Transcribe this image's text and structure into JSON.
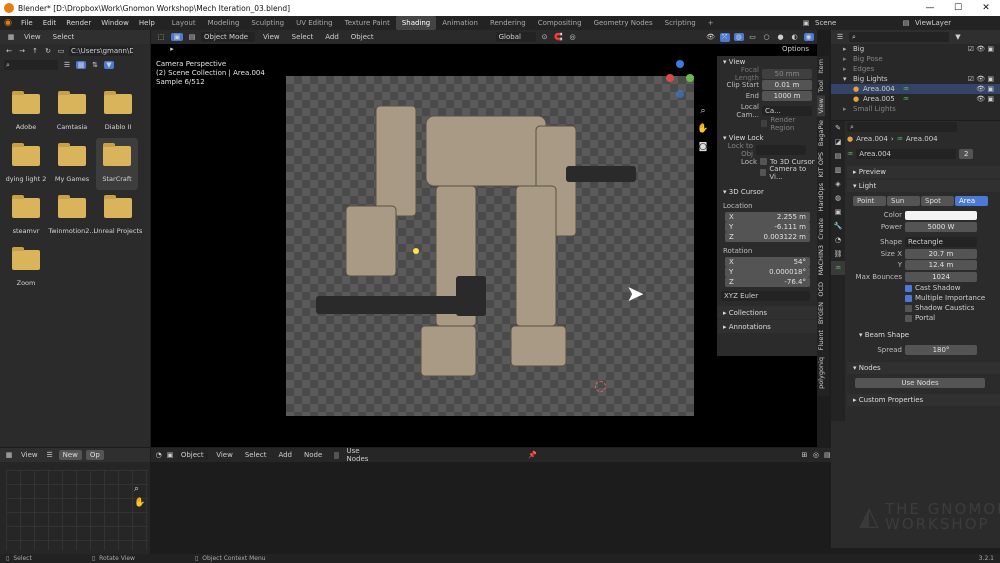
{
  "title_bar": {
    "text": "Blender* [D:\\Dropbox\\Work\\Gnomon Workshop\\Mech Iteration_03.blend]"
  },
  "menu": {
    "items": [
      "File",
      "Edit",
      "Render",
      "Window",
      "Help"
    ],
    "workspaces": [
      "Layout",
      "Modeling",
      "Sculpting",
      "UV Editing",
      "Texture Paint",
      "Shading",
      "Animation",
      "Rendering",
      "Compositing",
      "Geometry Nodes",
      "Scripting"
    ],
    "active_workspace": "Shading",
    "add_label": "+",
    "scene_label": "Scene",
    "viewlayer_label": "ViewLayer"
  },
  "file_browser": {
    "header": {
      "view": "View",
      "select": "Select"
    },
    "path": "C:\\Users\\gmann\\Docu...",
    "folders": [
      "Adobe",
      "Camtasia",
      "Diablo II",
      "dying light 2",
      "My Games",
      "StarCraft",
      "steamvr",
      "Twinmotion2...",
      "Unreal Projects",
      "Zoom"
    ]
  },
  "viewport": {
    "mode": "Object Mode",
    "menus": [
      "View",
      "Select",
      "Add",
      "Object"
    ],
    "transform": "Global",
    "options": "Options",
    "overlay": {
      "line1": "Camera Perspective",
      "line2": "(2) Scene Collection | Area.004",
      "line3": "Sample 6/512"
    }
  },
  "n_panel": {
    "view_title": "View",
    "focal_length": {
      "label": "Focal Length",
      "value": "50 mm"
    },
    "clip_start": {
      "label": "Clip Start",
      "value": "0.01 m"
    },
    "clip_end": {
      "label": "End",
      "value": "1000 m"
    },
    "local_camera": {
      "label": "Local Cam...",
      "value": "Ca..."
    },
    "render_region": "Render Region",
    "view_lock_title": "View Lock",
    "lock_to_object": "Lock to Obj",
    "lock_label": "Lock",
    "to_3d_cursor": "To 3D Cursor",
    "camera_to_view": "Camera to Vi...",
    "cursor_title": "3D Cursor",
    "location_label": "Location",
    "loc": [
      {
        "axis": "X",
        "value": "2.255 m"
      },
      {
        "axis": "Y",
        "value": "-6.111 m"
      },
      {
        "axis": "Z",
        "value": "0.003122 m"
      }
    ],
    "rotation_label": "Rotation",
    "rot": [
      {
        "axis": "X",
        "value": "54°"
      },
      {
        "axis": "Y",
        "value": "0.000018°"
      },
      {
        "axis": "Z",
        "value": "-76.4°"
      }
    ],
    "rotation_mode": "XYZ Euler",
    "collections": "Collections",
    "annotations": "Annotations",
    "tabs": [
      "Item",
      "Tool",
      "View",
      "BagaPie",
      "KIT OPS",
      "HardOps",
      "Create",
      "MACHIN3",
      "OCD",
      "BYGEN",
      "Fluent",
      "polygoniq"
    ]
  },
  "outliner": {
    "items": [
      {
        "name": "Big",
        "indent": 0
      },
      {
        "name": "Big Pose",
        "indent": 0
      },
      {
        "name": "Edges",
        "indent": 0
      },
      {
        "name": "Big Lights",
        "indent": 0
      },
      {
        "name": "Area.004",
        "indent": 1
      },
      {
        "name": "Area.005",
        "indent": 1
      },
      {
        "name": "Small Lights",
        "indent": 0
      }
    ]
  },
  "properties": {
    "breadcrumb": [
      "Area.004",
      "Area.004"
    ],
    "datablock": "Area.004",
    "users": "2",
    "preview": "Preview",
    "light": "Light",
    "light_types": [
      "Point",
      "Sun",
      "Spot",
      "Area"
    ],
    "active_light_type": "Area",
    "color_label": "Color",
    "power": {
      "label": "Power",
      "value": "5000 W"
    },
    "shape": {
      "label": "Shape",
      "value": "Rectangle"
    },
    "size_x": {
      "label": "Size X",
      "value": "20.7 m"
    },
    "size_y": {
      "label": "Y",
      "value": "12.4 m"
    },
    "max_bounces": {
      "label": "Max Bounces",
      "value": "1024"
    },
    "cast_shadow": "Cast Shadow",
    "multiple_importance": "Multiple Importance",
    "shadow_caustics": "Shadow Caustics",
    "portal": "Portal",
    "beam_shape": "Beam Shape",
    "spread": {
      "label": "Spread",
      "value": "180°"
    },
    "nodes": "Nodes",
    "use_nodes": "Use Nodes",
    "custom_properties": "Custom Properties"
  },
  "bottom_left": {
    "view": "View",
    "new": "New",
    "open": "Op"
  },
  "node_editor": {
    "mode": "Object",
    "menus": [
      "View",
      "Select",
      "Add",
      "Node"
    ],
    "use_nodes": "Use Nodes"
  },
  "status_bar": {
    "select": "Select",
    "rotate": "Rotate View",
    "context": "Object Context Menu",
    "version": "3.2.1"
  },
  "watermark": {
    "line1": "THE GNOMON",
    "line2": "WORKSHOP"
  },
  "colors": {
    "accent": "#4a7ad3",
    "folder": "#d9b45a",
    "light_green": "#5fbf6a"
  }
}
